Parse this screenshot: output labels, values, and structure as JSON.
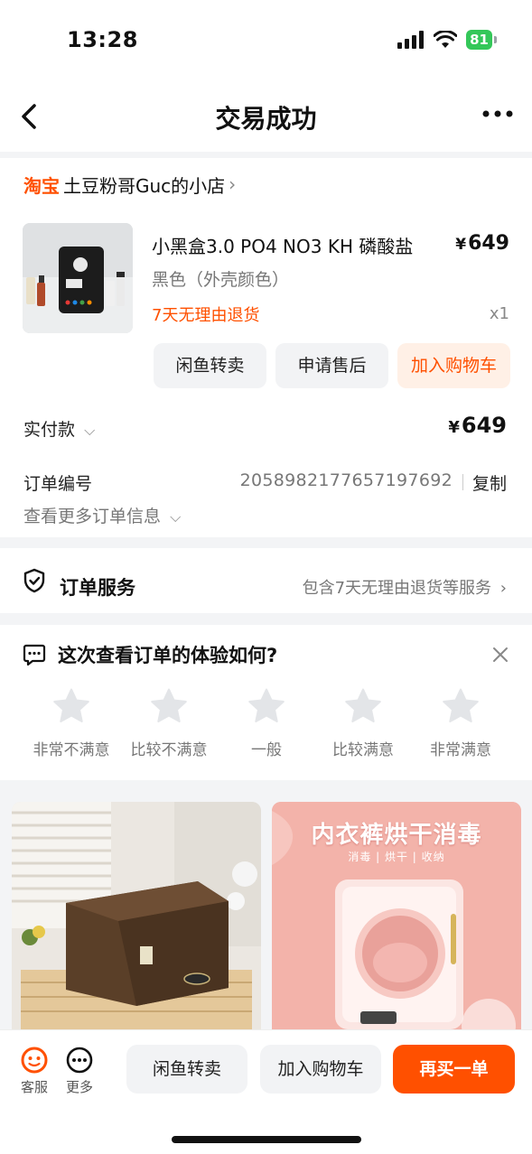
{
  "status_bar": {
    "time": "13:28",
    "battery": "81"
  },
  "nav": {
    "title": "交易成功"
  },
  "shop": {
    "brand": "淘宝",
    "name": "土豆粉哥Guc的小店"
  },
  "product": {
    "title": "小黑盒3.0 PO4 NO3 KH 磷酸盐",
    "price_symbol": "¥",
    "price": "649",
    "variant": "黑色（外壳颜色）",
    "return_policy": "7天无理由退货",
    "quantity": "x1"
  },
  "item_actions": {
    "resell": "闲鱼转卖",
    "after_sale": "申请售后",
    "add_cart": "加入购物车"
  },
  "payment": {
    "label": "实付款",
    "symbol": "¥",
    "amount": "649"
  },
  "order": {
    "label": "订单编号",
    "number": "2058982177657197692",
    "copy": "复制",
    "more_info": "查看更多订单信息"
  },
  "service": {
    "label": "订单服务",
    "value": "包含7天无理由退货等服务"
  },
  "feedback": {
    "title": "这次查看订单的体验如何?",
    "ratings": [
      "非常不满意",
      "比较不满意",
      "一般",
      "比较满意",
      "非常满意"
    ]
  },
  "recommendations": {
    "right_banner": "内衣裤烘干消毒",
    "right_sub": "消毒 | 烘干 | 收纳"
  },
  "bottom_bar": {
    "service": "客服",
    "more": "更多",
    "resell": "闲鱼转卖",
    "add_cart": "加入购物车",
    "rebuy": "再买一单"
  },
  "colors": {
    "accent": "#ff5000",
    "accent_light": "#fff0e6",
    "star": "#e3e5e8",
    "battery": "#34c759"
  },
  "icons": [
    "back-icon",
    "more-icon",
    "shield-icon",
    "chat-icon",
    "close-icon",
    "star-icon",
    "customer-service-icon",
    "ellipsis-circle-icon"
  ]
}
